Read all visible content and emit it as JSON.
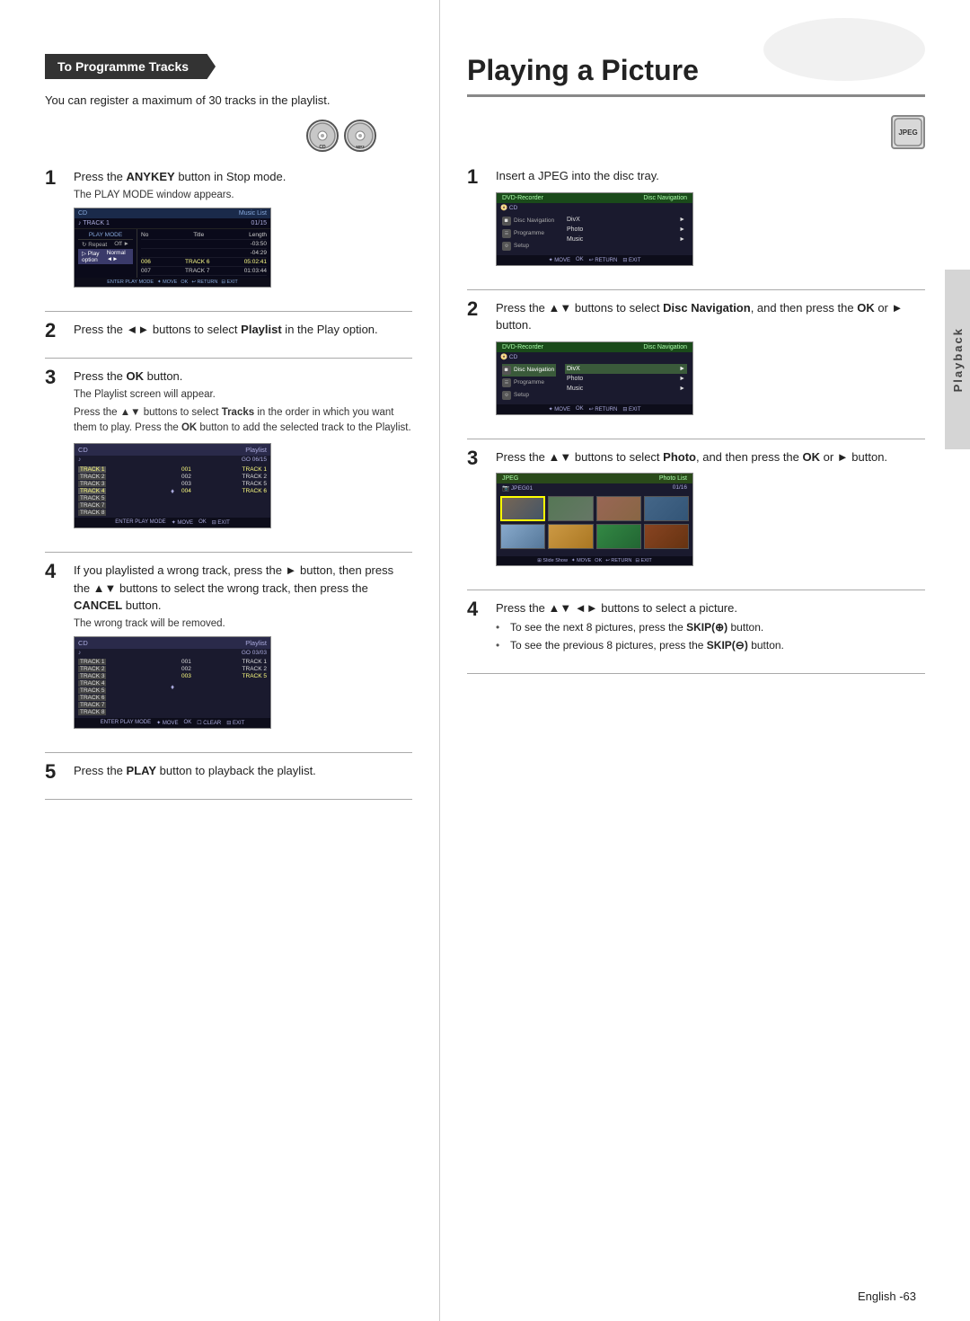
{
  "left": {
    "section_header": "To Programme Tracks",
    "intro": "You can register a maximum of 30 tracks in the playlist.",
    "disc_labels": [
      "CD",
      "MP3"
    ],
    "steps": [
      {
        "number": "1",
        "title": "Press the ANYKEY button in Stop mode.",
        "sub": "The PLAY MODE window appears.",
        "screen_type": "play_mode"
      },
      {
        "number": "2",
        "title": "Press the ◄► buttons to select Playlist in the Play option.",
        "screen_type": null
      },
      {
        "number": "3",
        "title": "Press the OK button.",
        "sub": "The Playlist screen will appear.",
        "desc": "Press the ▲▼ buttons to select Tracks in the order in which you want them to play. Press the OK button to add the selected track to the Playlist.",
        "screen_type": "playlist1"
      },
      {
        "number": "4",
        "title": "If you playlisted a wrong track, press the ► button, then press the ▲▼ buttons to select the wrong track, then press the CANCEL button.",
        "sub": "The wrong track will be removed.",
        "screen_type": "playlist2"
      },
      {
        "number": "5",
        "title": "Press the PLAY button to playback the playlist.",
        "screen_type": null
      }
    ]
  },
  "right": {
    "title": "Playing a Picture",
    "jpeg_icon_label": "JPEG",
    "steps": [
      {
        "number": "1",
        "title": "Insert a JPEG into the disc tray.",
        "screen_type": "dvd1"
      },
      {
        "number": "2",
        "title": "Press the ▲▼ buttons to select Disc Navigation, and then press the OK or ► button.",
        "screen_type": "dvd2"
      },
      {
        "number": "3",
        "title": "Press the ▲▼ buttons to select Photo, and then press the OK or ► button.",
        "screen_type": "jpeg_grid"
      },
      {
        "number": "4",
        "title": "Press the ▲▼ ◄► buttons to select a picture.",
        "bullets": [
          "To see the next 8 pictures, press the SKIP(⊕) button.",
          "To see the previous 8 pictures, press the SKIP(⊖) button."
        ]
      }
    ]
  },
  "sidebar_label": "Playback",
  "page_number": "English -63"
}
